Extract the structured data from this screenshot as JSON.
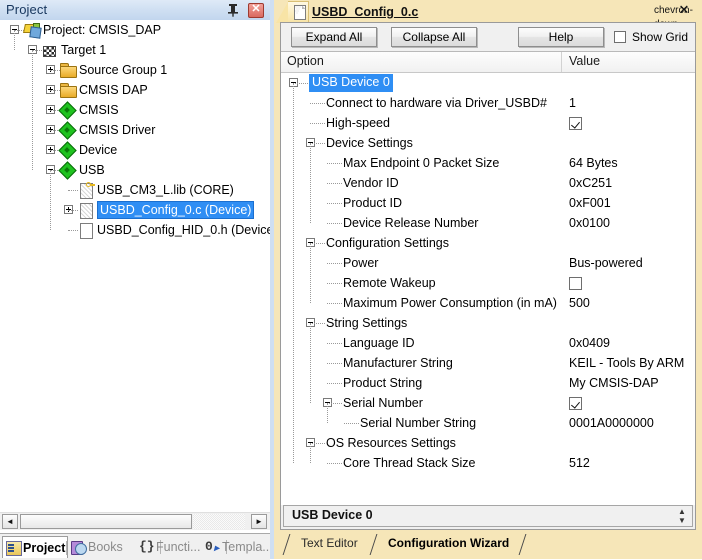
{
  "project_panel": {
    "title": "Project",
    "pin_icon": "pin-icon",
    "close_icon": "close-icon",
    "tree": [
      {
        "label": "Project: CMSIS_DAP",
        "depth": 0,
        "expander": "minus",
        "icon": "project-icon",
        "selected": false
      },
      {
        "label": "Target 1",
        "depth": 1,
        "expander": "minus",
        "icon": "target-icon",
        "selected": false
      },
      {
        "label": "Source Group 1",
        "depth": 2,
        "expander": "plus",
        "icon": "folder-icon",
        "selected": false
      },
      {
        "label": "CMSIS DAP",
        "depth": 2,
        "expander": "plus",
        "icon": "folder-icon",
        "selected": false
      },
      {
        "label": "CMSIS",
        "depth": 2,
        "expander": "plus",
        "icon": "diamond-icon",
        "selected": false
      },
      {
        "label": "CMSIS Driver",
        "depth": 2,
        "expander": "plus",
        "icon": "diamond-icon",
        "selected": false
      },
      {
        "label": "Device",
        "depth": 2,
        "expander": "plus",
        "icon": "diamond-icon",
        "selected": false
      },
      {
        "label": "USB",
        "depth": 2,
        "expander": "minus",
        "icon": "diamond-icon",
        "selected": false
      },
      {
        "label": "USB_CM3_L.lib (CORE)",
        "depth": 3,
        "expander": "none",
        "icon": "library-file-icon",
        "selected": false
      },
      {
        "label": "USBD_Config_0.c (Device)",
        "depth": 3,
        "expander": "plus",
        "icon": "c-file-icon",
        "selected": true
      },
      {
        "label": "USBD_Config_HID_0.h (Device:",
        "depth": 3,
        "expander": "none",
        "icon": "h-file-icon",
        "selected": false
      }
    ],
    "hscrollbar": {
      "left_arrow": "◄",
      "right_arrow": "►"
    },
    "bottom_tabs": [
      {
        "label": "Project",
        "icon": "project-tab-icon",
        "active": true
      },
      {
        "label": "Books",
        "icon": "books-icon",
        "active": false
      },
      {
        "label": "Functi...",
        "icon": "functions-icon",
        "active": false
      },
      {
        "label": "Templa...",
        "icon": "templates-icon",
        "active": false
      }
    ]
  },
  "editor": {
    "tab": {
      "label": "USBD_Config_0.c",
      "icon": "c-file-icon",
      "dropdown_icon": "chevron-down-icon",
      "close_icon": "close-icon"
    },
    "toolbar": {
      "expand_all": "Expand All",
      "collapse_all": "Collapse All",
      "help": "Help",
      "show_grid": "Show Grid",
      "show_grid_checked": false
    },
    "columns": {
      "option": "Option",
      "value": "Value"
    },
    "rows": [
      {
        "label": "USB Device 0",
        "depth": 0,
        "expander": "minus",
        "value": "",
        "type": "text",
        "selected": true
      },
      {
        "label": "Connect to hardware via Driver_USBD#",
        "depth": 1,
        "expander": "none",
        "value": "1",
        "type": "text",
        "selected": false
      },
      {
        "label": "High-speed",
        "depth": 1,
        "expander": "none",
        "value": "",
        "type": "checkbox",
        "checked": true,
        "selected": false
      },
      {
        "label": "Device Settings",
        "depth": 1,
        "expander": "minus",
        "value": "",
        "type": "text",
        "selected": false
      },
      {
        "label": "Max Endpoint 0 Packet Size",
        "depth": 2,
        "expander": "none",
        "value": "64 Bytes",
        "type": "text",
        "selected": false
      },
      {
        "label": "Vendor ID",
        "depth": 2,
        "expander": "none",
        "value": "0xC251",
        "type": "text",
        "selected": false
      },
      {
        "label": "Product ID",
        "depth": 2,
        "expander": "none",
        "value": "0xF001",
        "type": "text",
        "selected": false
      },
      {
        "label": "Device Release Number",
        "depth": 2,
        "expander": "none",
        "value": "0x0100",
        "type": "text",
        "selected": false
      },
      {
        "label": "Configuration Settings",
        "depth": 1,
        "expander": "minus",
        "value": "",
        "type": "text",
        "selected": false
      },
      {
        "label": "Power",
        "depth": 2,
        "expander": "none",
        "value": "Bus-powered",
        "type": "text",
        "selected": false
      },
      {
        "label": "Remote Wakeup",
        "depth": 2,
        "expander": "none",
        "value": "",
        "type": "checkbox",
        "checked": false,
        "selected": false
      },
      {
        "label": "Maximum Power Consumption (in mA)",
        "depth": 2,
        "expander": "none",
        "value": "500",
        "type": "text",
        "selected": false
      },
      {
        "label": "String Settings",
        "depth": 1,
        "expander": "minus",
        "value": "",
        "type": "text",
        "selected": false
      },
      {
        "label": "Language ID",
        "depth": 2,
        "expander": "none",
        "value": "0x0409",
        "type": "text",
        "selected": false
      },
      {
        "label": "Manufacturer String",
        "depth": 2,
        "expander": "none",
        "value": "KEIL - Tools By ARM",
        "type": "text",
        "selected": false
      },
      {
        "label": "Product String",
        "depth": 2,
        "expander": "none",
        "value": "My CMSIS-DAP",
        "type": "text",
        "selected": false
      },
      {
        "label": "Serial Number",
        "depth": 2,
        "expander": "minus",
        "value": "",
        "type": "checkbox",
        "checked": true,
        "selected": false
      },
      {
        "label": "Serial Number String",
        "depth": 3,
        "expander": "none",
        "value": "0001A0000000",
        "type": "text",
        "selected": false
      },
      {
        "label": "OS Resources Settings",
        "depth": 1,
        "expander": "minus",
        "value": "",
        "type": "text",
        "selected": false
      },
      {
        "label": "Core Thread Stack Size",
        "depth": 2,
        "expander": "none",
        "value": "512",
        "type": "text",
        "selected": false
      }
    ],
    "status_bar": {
      "text": "USB Device 0",
      "spinner_up": "▲",
      "spinner_down": "▼"
    },
    "bottom_tabs": [
      {
        "label": "Text Editor",
        "active": false
      },
      {
        "label": "Configuration Wizard",
        "active": true
      }
    ]
  }
}
